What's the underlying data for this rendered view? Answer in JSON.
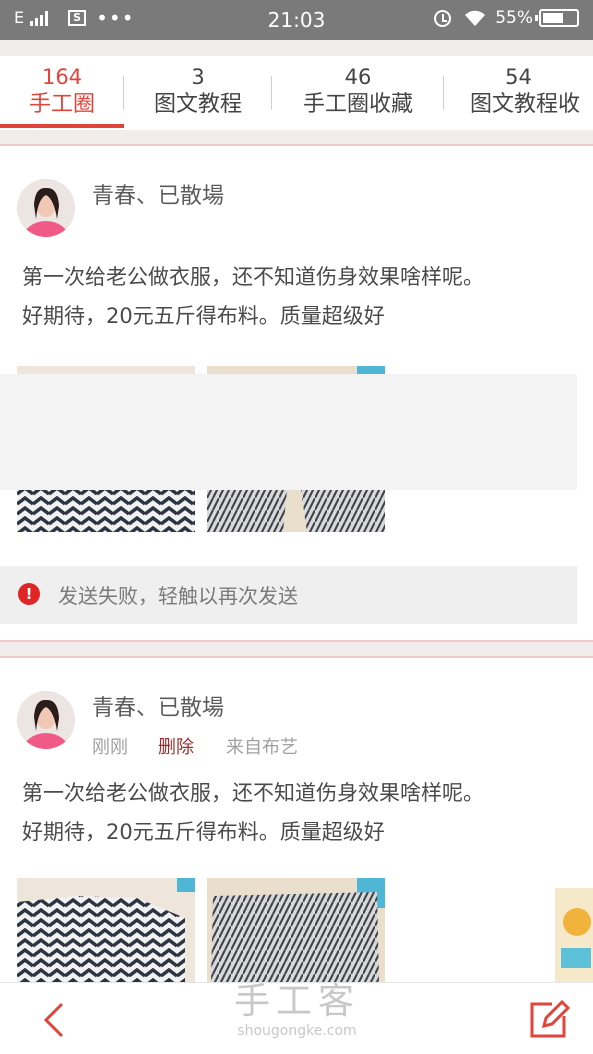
{
  "status_bar": {
    "network": "E",
    "sim_label": "S",
    "dots": "•••",
    "time": "21:03",
    "battery": "55%",
    "icons": [
      "signal-icon",
      "sim-icon",
      "alarm-icon",
      "wifi-icon",
      "battery-icon"
    ]
  },
  "tabs": [
    {
      "count": "164",
      "label": "手工圈",
      "active": true
    },
    {
      "count": "3",
      "label": "图文教程",
      "active": false
    },
    {
      "count": "46",
      "label": "手工圈收藏",
      "active": false
    },
    {
      "count": "54",
      "label": "图文教程收",
      "active": false
    }
  ],
  "posts": [
    {
      "username": "青春、已散場",
      "text_line1": "第一次给老公做衣服，还不知道伤身效果啥样呢。",
      "text_line2": "好期待，20元五斤得布料。质量超级好",
      "failed_message": "发送失败，轻触以再次发送",
      "images": [
        "zigzag-shirt-photo",
        "patterned-shorts-photo"
      ]
    },
    {
      "username": "青春、已散場",
      "time": "刚刚",
      "delete_label": "删除",
      "source": "来自布艺",
      "text_line1": "第一次给老公做衣服，还不知道伤身效果啥样呢。",
      "text_line2": "好期待，20元五斤得布料。质量超级好",
      "images": [
        "zigzag-shirt-photo",
        "patterned-shorts-photo"
      ]
    }
  ],
  "bottom_bar": {
    "watermark_cn": "手工客",
    "watermark_en": "shougongke.com"
  },
  "colors": {
    "accent": "#e0453c",
    "status_bar": "#7a7a7a",
    "error": "#e02525",
    "delete": "#9e2c2c"
  }
}
